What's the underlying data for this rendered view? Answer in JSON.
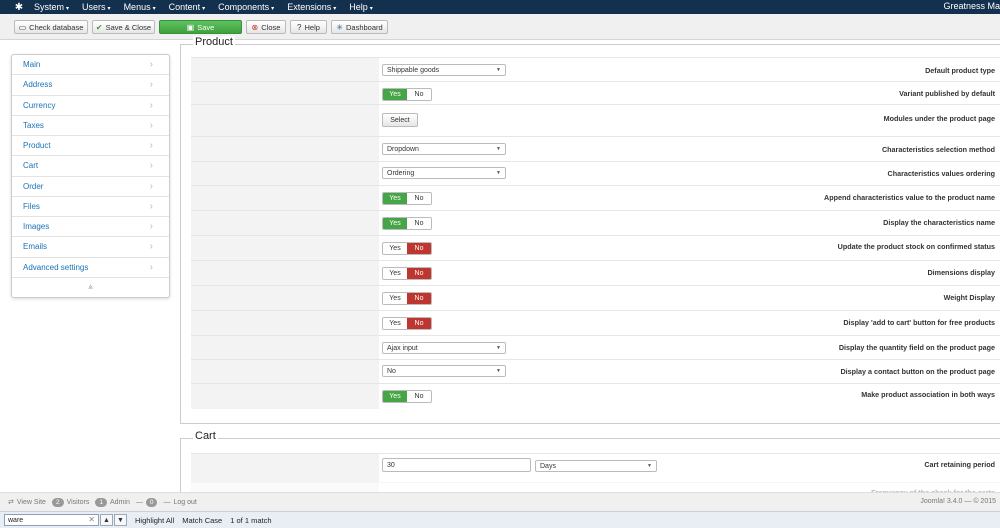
{
  "navbar": {
    "logo_icon": "joomla-logo-icon",
    "menus": [
      {
        "label": "System"
      },
      {
        "label": "Users"
      },
      {
        "label": "Menus"
      },
      {
        "label": "Content"
      },
      {
        "label": "Components"
      },
      {
        "label": "Extensions"
      },
      {
        "label": "Help"
      }
    ],
    "caret": "▾",
    "site_name": "Greatness Ma"
  },
  "toolbar": {
    "check_database": "Check database",
    "save_close": "Save & Close",
    "save": "Save",
    "close": "Close",
    "help": "Help",
    "dashboard": "Dashboard"
  },
  "sidebar": {
    "items": [
      {
        "label": "Main"
      },
      {
        "label": "Address"
      },
      {
        "label": "Currency"
      },
      {
        "label": "Taxes"
      },
      {
        "label": "Product"
      },
      {
        "label": "Cart"
      },
      {
        "label": "Order"
      },
      {
        "label": "Files"
      },
      {
        "label": "Images"
      },
      {
        "label": "Emails"
      },
      {
        "label": "Advanced settings"
      }
    ],
    "collapse_glyph": "⩓"
  },
  "product": {
    "legend": "Product",
    "rows": [
      {
        "label": "Default product type",
        "type": "select",
        "value": "Shippable goods"
      },
      {
        "label": "Variant published by default",
        "type": "yesno",
        "selected": "yes"
      },
      {
        "label": "Modules under the product page",
        "type": "button",
        "value": "Select"
      },
      {
        "label": "Characteristics selection method",
        "type": "select",
        "value": "Dropdown"
      },
      {
        "label": "Characteristics values ordering",
        "type": "select",
        "value": "Ordering"
      },
      {
        "label": "Append characteristics value to the product name",
        "type": "yesno",
        "selected": "yes"
      },
      {
        "label": "Display the characteristics name",
        "type": "yesno",
        "selected": "yes"
      },
      {
        "label": "Update the product stock on confirmed status",
        "type": "yesno",
        "selected": "no"
      },
      {
        "label": "Dimensions display",
        "type": "yesno",
        "selected": "no"
      },
      {
        "label": "Weight Display",
        "type": "yesno",
        "selected": "no"
      },
      {
        "label": "Display 'add to cart' button for free products",
        "type": "yesno",
        "selected": "no"
      },
      {
        "label": "Display the quantity field on the product page",
        "type": "select",
        "value": "Ajax input"
      },
      {
        "label": "Display a contact button on the product page",
        "type": "select",
        "value": "No"
      },
      {
        "label": "Make product association in both ways",
        "type": "yesno",
        "selected": "yes"
      }
    ],
    "yes_label": "Yes",
    "no_label": "No"
  },
  "cart": {
    "legend": "Cart",
    "retaining_label": "Cart retaining period",
    "retaining_value": "30",
    "retaining_unit": "Days",
    "next_label": "Frequency of the check for the carts"
  },
  "statusbar": {
    "view_site": "View Site",
    "visitors_count": "2",
    "visitors_label": "Visitors",
    "admin_count": "1",
    "admin_label": "Admin",
    "messages_count": "0",
    "logout": "Log out",
    "version": "Joomla! 3.4.0 — © 2015"
  },
  "findbar": {
    "query": "ware",
    "highlight_all": "Highlight All",
    "match_case": "Match Case",
    "result": "1 of 1 match"
  },
  "colors": {
    "navbar": "#14304f",
    "save_green": "#46a546",
    "no_red": "#bd362f",
    "link_blue": "#1a73b5"
  }
}
